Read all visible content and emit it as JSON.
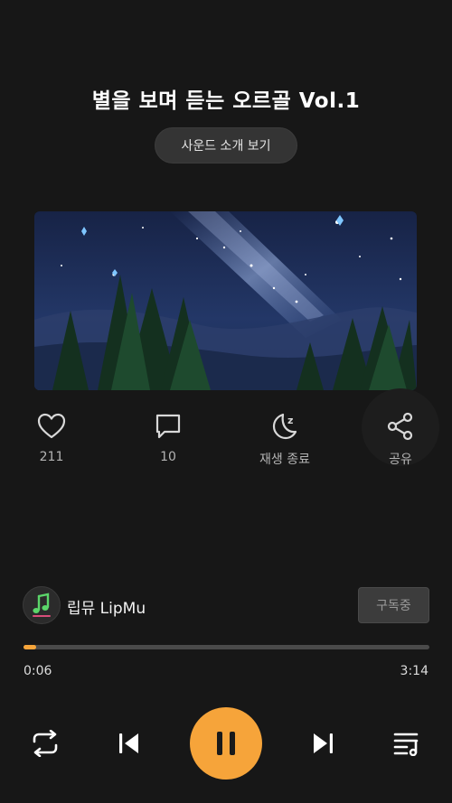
{
  "track": {
    "title": "별을 보며 듣는 오르골 Vol.1",
    "intro_button": "사운드 소개 보기"
  },
  "actions": {
    "like": {
      "icon": "heart-icon",
      "label": "211"
    },
    "comment": {
      "icon": "comment-icon",
      "label": "10"
    },
    "sleep": {
      "icon": "moon-sleep-icon",
      "label": "재생 종료"
    },
    "share": {
      "icon": "share-icon",
      "label": "공유"
    }
  },
  "channel": {
    "name": "립뮤 LipMu",
    "subscribe_label": "구독중"
  },
  "player": {
    "current_time": "0:06",
    "total_time": "3:14",
    "progress_fraction": 0.032
  },
  "colors": {
    "background": "#171717",
    "accent": "#f6a43a"
  }
}
